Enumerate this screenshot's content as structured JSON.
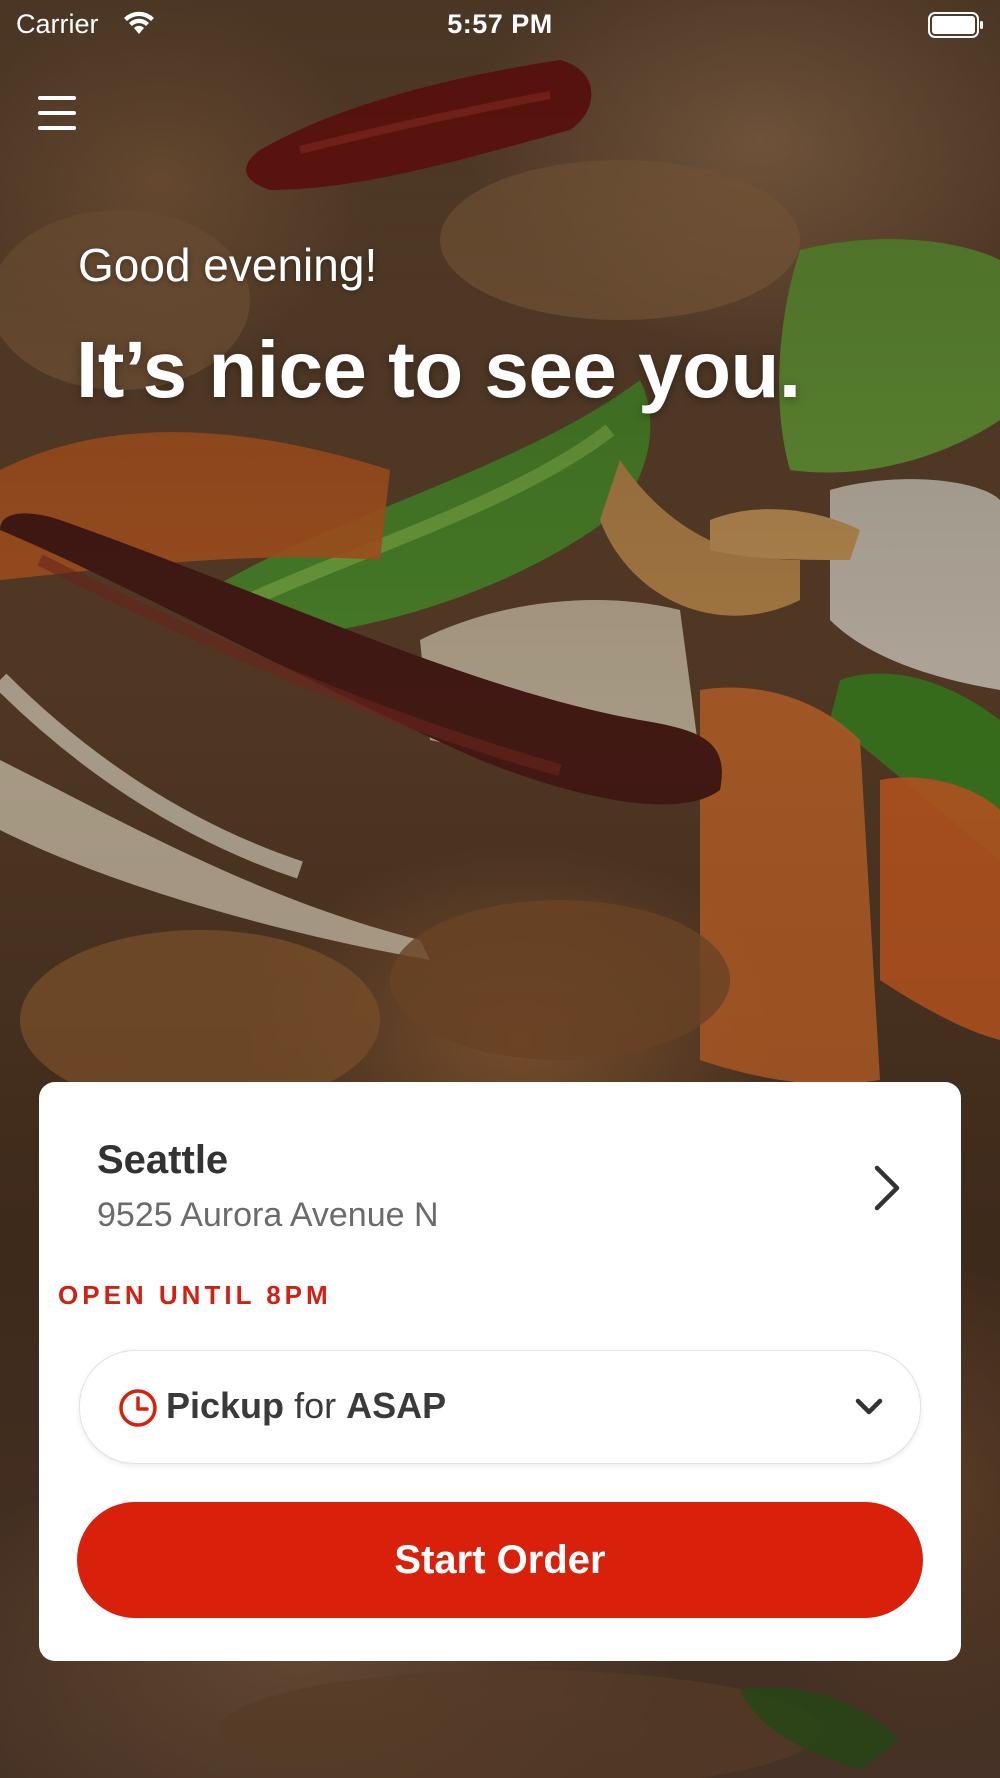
{
  "status_bar": {
    "carrier": "Carrier",
    "time": "5:57 PM"
  },
  "hero": {
    "greeting": "Good evening!",
    "headline": "It’s nice to see you."
  },
  "location": {
    "name": "Seattle",
    "address": "9525 Aurora Avenue N",
    "hours": "OPEN UNTIL 8PM"
  },
  "order_mode": {
    "mode": "Pickup",
    "connector": "for",
    "time": "ASAP"
  },
  "actions": {
    "start_order": "Start Order"
  },
  "colors": {
    "accent": "#d9200b",
    "hours_text": "#d42012",
    "card_bg": "#ffffff"
  },
  "icons": {
    "menu": "hamburger-menu-icon",
    "location_chevron": "chevron-right-icon",
    "clock": "clock-icon",
    "dropdown": "chevron-down-icon",
    "wifi": "wifi-icon",
    "battery": "battery-icon"
  }
}
